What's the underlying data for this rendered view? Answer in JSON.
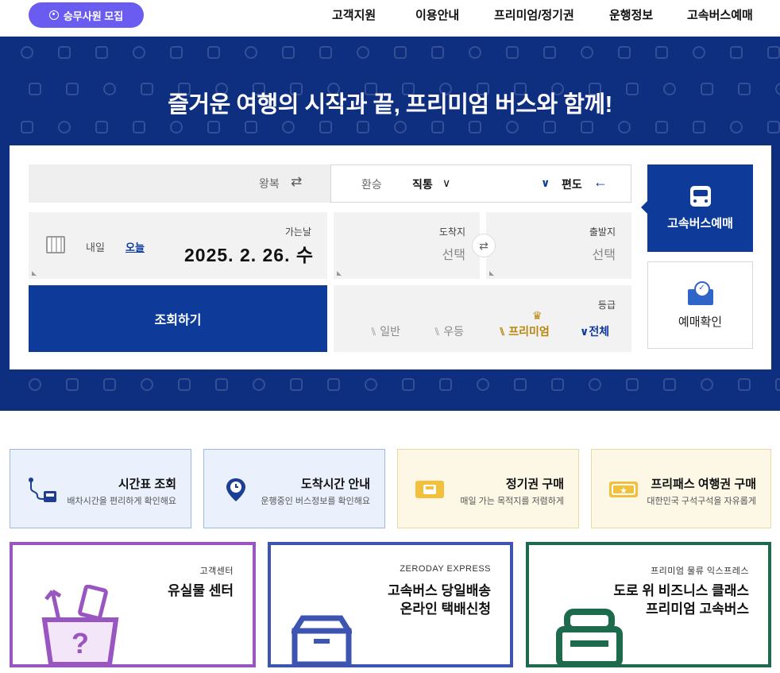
{
  "nav": {
    "recruit_btn": "승무사원 모집",
    "items": [
      "고속버스예매",
      "운행정보",
      "프리미엄/정기권",
      "이용안내",
      "고객지원"
    ]
  },
  "hero": {
    "title": "즐거운 여행의 시작과 끝, 프리미엄 버스와 함께!"
  },
  "tabs": {
    "bus": "고속버스예매",
    "check": "예매확인"
  },
  "trip": {
    "oneway": "편도",
    "direct": "직통",
    "transfer": "환승",
    "roundtrip": "왕복"
  },
  "fields": {
    "departure_label": "출발지",
    "departure_value": "선택",
    "arrival_label": "도착지",
    "arrival_value": "선택",
    "date_label": "가는날",
    "date_value": "2025. 2. 26. 수",
    "today": "오늘",
    "tomorrow": "내일",
    "grade_label": "등급",
    "grade_all": "전체",
    "grade_premium": "프리미엄",
    "grade_excellent": "우등",
    "grade_normal": "일반"
  },
  "search_btn": "조회하기",
  "features": [
    {
      "title": "프리패스 여행권 구매",
      "sub": "대한민국 구석구석을 자유롭게"
    },
    {
      "title": "정기권 구매",
      "sub": "매일 가는 목적지를 저렴하게"
    },
    {
      "title": "도착시간 안내",
      "sub": "운행중인 버스정보를 확인해요"
    },
    {
      "title": "시간표 조회",
      "sub": "배차시간을 편리하게 확인해요"
    }
  ],
  "promos": [
    {
      "sup": "프리미엄 물류 익스프레스",
      "line1": "도로 위 비즈니스 클래스",
      "line2": "프리미엄 고속버스"
    },
    {
      "sup": "ZERODAY EXPRESS",
      "line1": "고속버스 당일배송",
      "line2": "온라인 택배신청"
    },
    {
      "sup": "고객센터",
      "line1": "유실물 센터",
      "line2": ""
    }
  ],
  "colors": {
    "brand_navy": "#0e2e80",
    "primary_blue": "#0e3a9a",
    "recruit_purple": "#6a5cf0",
    "promo_green": "#1d6a4c",
    "promo_blue": "#3d55b0",
    "promo_purple": "#9a56c0"
  }
}
